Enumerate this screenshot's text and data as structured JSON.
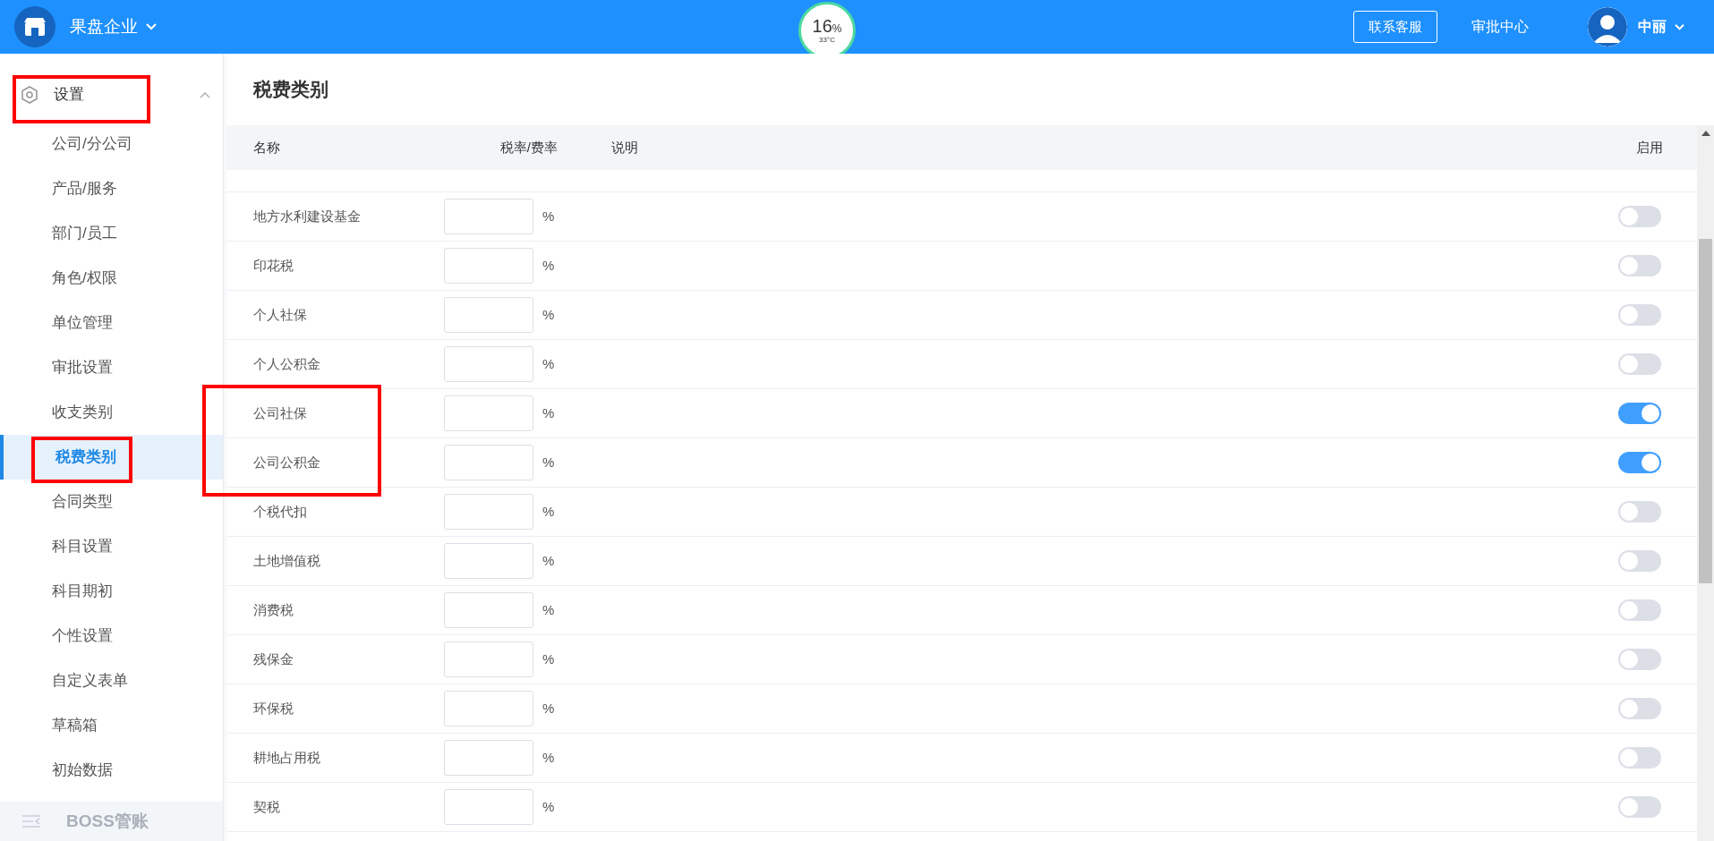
{
  "topbar": {
    "company": "果盘企业",
    "gauge": {
      "percent": "16",
      "unit": "%",
      "temp": "33°C"
    },
    "contact_button": "联系客服",
    "approval_link": "审批中心",
    "user": "中丽"
  },
  "sidebar": {
    "section": {
      "label": "设置",
      "expanded": true
    },
    "items": [
      {
        "label": "公司/分公司",
        "selected": false
      },
      {
        "label": "产品/服务",
        "selected": false
      },
      {
        "label": "部门/员工",
        "selected": false
      },
      {
        "label": "角色/权限",
        "selected": false
      },
      {
        "label": "单位管理",
        "selected": false
      },
      {
        "label": "审批设置",
        "selected": false
      },
      {
        "label": "收支类别",
        "selected": false
      },
      {
        "label": "税费类别",
        "selected": true
      },
      {
        "label": "合同类型",
        "selected": false
      },
      {
        "label": "科目设置",
        "selected": false
      },
      {
        "label": "科目期初",
        "selected": false
      },
      {
        "label": "个性设置",
        "selected": false
      },
      {
        "label": "自定义表单",
        "selected": false
      },
      {
        "label": "草稿箱",
        "selected": false
      },
      {
        "label": "初始数据",
        "selected": false
      }
    ],
    "footer": "BOSS管账"
  },
  "page_title": "税费类别",
  "table": {
    "columns": [
      "名称",
      "税率/费率",
      "说明",
      "启用"
    ],
    "rows": [
      {
        "name": "地方水利建设基金",
        "unit": "%",
        "on": false
      },
      {
        "name": "印花税",
        "unit": "%",
        "on": false
      },
      {
        "name": "个人社保",
        "unit": "%",
        "on": false
      },
      {
        "name": "个人公积金",
        "unit": "%",
        "on": false
      },
      {
        "name": "公司社保",
        "unit": "%",
        "on": true
      },
      {
        "name": "公司公积金",
        "unit": "%",
        "on": true
      },
      {
        "name": "个税代扣",
        "unit": "%",
        "on": false
      },
      {
        "name": "土地增值税",
        "unit": "%",
        "on": false
      },
      {
        "name": "消费税",
        "unit": "%",
        "on": false
      },
      {
        "name": "残保金",
        "unit": "%",
        "on": false
      },
      {
        "name": "环保税",
        "unit": "%",
        "on": false
      },
      {
        "name": "耕地占用税",
        "unit": "%",
        "on": false
      },
      {
        "name": "契税",
        "unit": "%",
        "on": false
      }
    ]
  }
}
